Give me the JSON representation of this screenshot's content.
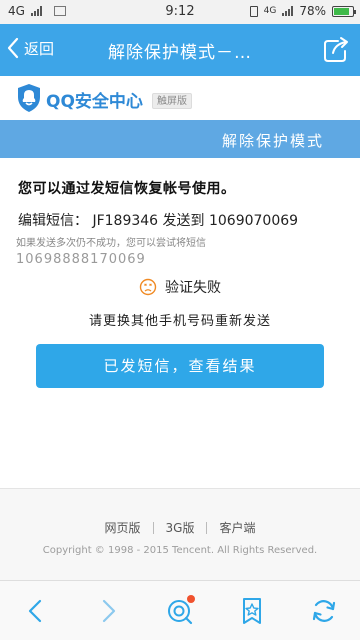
{
  "status_bar": {
    "network_left": "4G",
    "time": "9:12",
    "network_right": "4G",
    "battery": "78%"
  },
  "nav": {
    "back_label": "返回",
    "title": "解除保护模式－…"
  },
  "brand": {
    "name": "QQ安全中心",
    "badge": "触屏版"
  },
  "section": {
    "title": "解除保护模式"
  },
  "content": {
    "intro": "您可以通过发短信恢复帐号使用。",
    "sms_instruction": "编辑短信： JF189346 发送到 1069070069",
    "fallback_hint": "如果发送多次仍不成功，您可以尝试将短信",
    "fallback_number": "10698888170069",
    "verify_status": "验证失败",
    "retry_hint": "请更换其他手机号码重新发送",
    "cta_label": "已发短信，查看结果"
  },
  "footer": {
    "links": [
      "网页版",
      "3G版",
      "客户端"
    ],
    "copyright": "Copyright © 1998 - 2015 Tencent. All Rights Reserved."
  },
  "toolbar": {
    "icons": [
      "back-icon",
      "forward-icon",
      "qq-browser-icon",
      "bookmark-star-icon",
      "refresh-icon"
    ]
  },
  "colors": {
    "nav_blue": "#3da5e8",
    "section_blue": "#5fa8e3",
    "cta_blue": "#2fa7e8",
    "brand_blue": "#2e89d6"
  }
}
